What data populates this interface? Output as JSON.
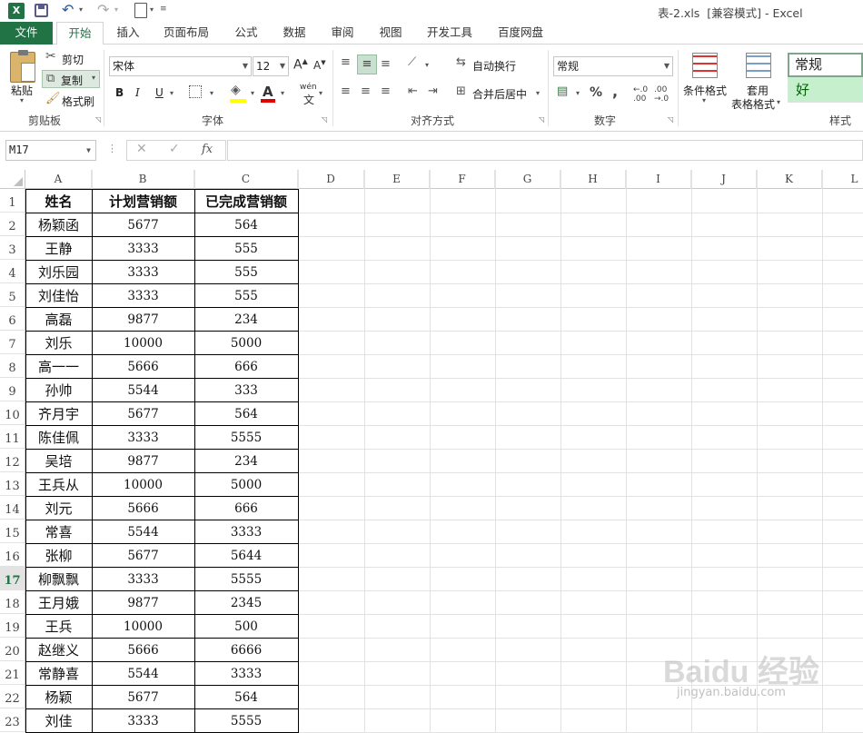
{
  "app": {
    "title": "表-2.xls  [兼容模式] - Excel",
    "icon": "excel-icon"
  },
  "tabs": [
    "文件",
    "开始",
    "插入",
    "页面布局",
    "公式",
    "数据",
    "审阅",
    "视图",
    "开发工具",
    "百度网盘"
  ],
  "ribbon": {
    "clipboard": {
      "paste": "粘贴",
      "cut": "剪切",
      "copy": "复制",
      "format_painter": "格式刷",
      "label": "剪贴板"
    },
    "font": {
      "name": "宋体",
      "size": "12",
      "label": "字体",
      "bold": "B",
      "italic": "I",
      "underline": "U",
      "font_color": "A",
      "wen": "wén"
    },
    "alignment": {
      "wrap": "自动换行",
      "merge": "合并后居中",
      "label": "对齐方式"
    },
    "number": {
      "format": "常规",
      "label": "数字",
      "percent": "%",
      "comma": ","
    },
    "styles": {
      "conditional": "条件格式",
      "table_format_1": "套用",
      "table_format_2": "表格格式",
      "normal": "常规",
      "good": "好",
      "label": "样式"
    }
  },
  "formula_bar": {
    "name_box": "M17",
    "fx": "fx",
    "value": ""
  },
  "columns": [
    "A",
    "B",
    "C",
    "D",
    "E",
    "F",
    "G",
    "H",
    "I",
    "J",
    "K",
    "L"
  ],
  "rows": [
    "1",
    "2",
    "3",
    "4",
    "5",
    "6",
    "7",
    "8",
    "9",
    "10",
    "11",
    "12",
    "13",
    "14",
    "15",
    "16",
    "17",
    "18",
    "19",
    "20",
    "21",
    "22",
    "23"
  ],
  "active_row": "17",
  "table": {
    "headers": [
      "姓名",
      "计划营销额",
      "已完成营销额"
    ],
    "rows": [
      [
        "杨颖函",
        "5677",
        "564"
      ],
      [
        "王静",
        "3333",
        "555"
      ],
      [
        "刘乐园",
        "3333",
        "555"
      ],
      [
        "刘佳怡",
        "3333",
        "555"
      ],
      [
        "高磊",
        "9877",
        "234"
      ],
      [
        "刘乐",
        "10000",
        "5000"
      ],
      [
        "高一一",
        "5666",
        "666"
      ],
      [
        "孙帅",
        "5544",
        "333"
      ],
      [
        "齐月宇",
        "5677",
        "564"
      ],
      [
        "陈佳佩",
        "3333",
        "5555"
      ],
      [
        "吴培",
        "9877",
        "234"
      ],
      [
        "王兵从",
        "10000",
        "5000"
      ],
      [
        "刘元",
        "5666",
        "666"
      ],
      [
        "常喜",
        "5544",
        "3333"
      ],
      [
        "张柳",
        "5677",
        "5644"
      ],
      [
        "柳飘飘",
        "3333",
        "5555"
      ],
      [
        "王月娥",
        "9877",
        "2345"
      ],
      [
        "王兵",
        "10000",
        "500"
      ],
      [
        "赵继义",
        "5666",
        "6666"
      ],
      [
        "常静喜",
        "5544",
        "3333"
      ],
      [
        "杨颖",
        "5677",
        "564"
      ],
      [
        "刘佳",
        "3333",
        "5555"
      ]
    ]
  },
  "watermark": {
    "brand": "Baidu 经验",
    "url": "jingyan.baidu.com"
  },
  "colors": {
    "excel_green": "#217346",
    "active_tab_text": "#217346",
    "good_style_bg": "#c6efce",
    "good_style_text": "#006100"
  }
}
